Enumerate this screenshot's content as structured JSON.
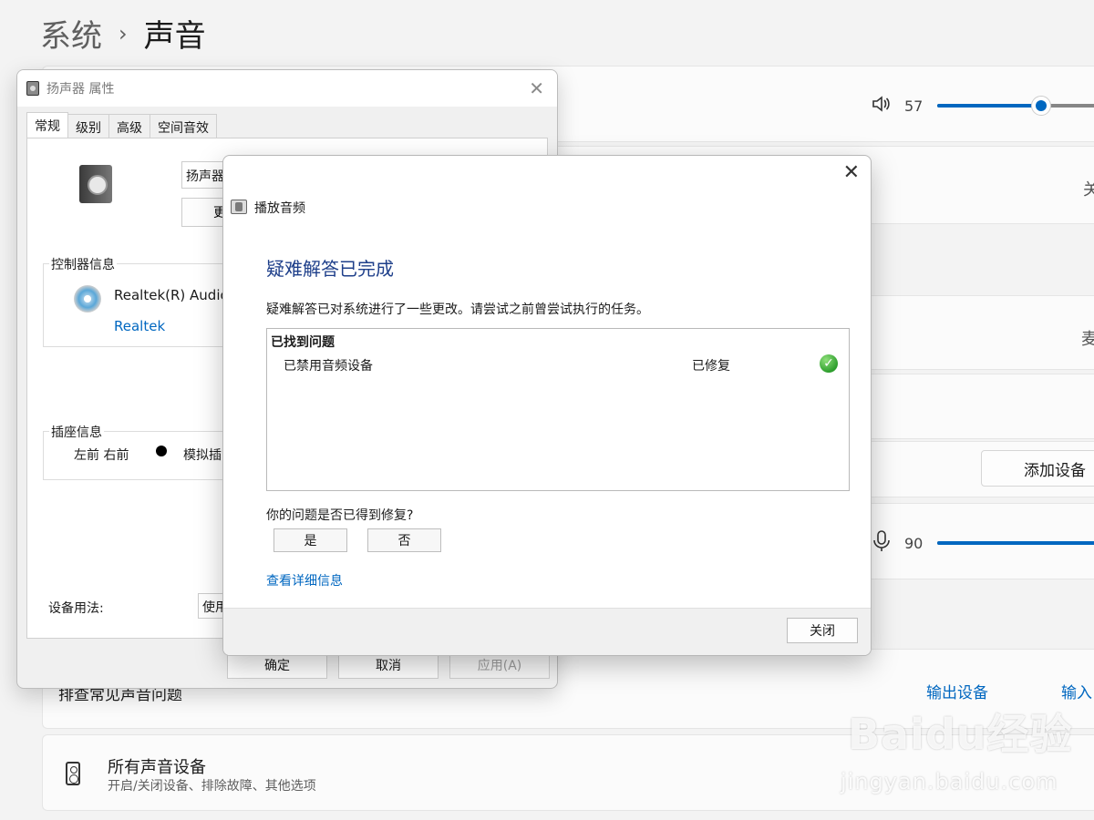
{
  "breadcrumb": {
    "parent": "系统",
    "separator": "›",
    "current": "声音"
  },
  "output_volume": {
    "value": "57",
    "level_percent": 57
  },
  "input_volume": {
    "value": "90",
    "level_percent": 90
  },
  "edge_labels": {
    "row_b": "关",
    "row_d": "麦"
  },
  "add_device_label": "添加设备",
  "troubleshoot": {
    "title": "排查常见声音问题",
    "output_link": "输出设备",
    "input_link": "输入"
  },
  "all_devices": {
    "title": "所有声音设备",
    "subtitle": "开启/关闭设备、排除故障、其他选项"
  },
  "watermark": {
    "logo": "Baidu经验",
    "url": "jingyan.baidu.com"
  },
  "props_dialog": {
    "title": "扬声器 属性",
    "tabs": [
      "常规",
      "级别",
      "高级",
      "空间音效"
    ],
    "device_name": "扬声器",
    "change_icon_btn": "更",
    "controller_group": "控制器信息",
    "controller_name": "Realtek(R) Audio",
    "controller_vendor": "Realtek",
    "jack_group": "插座信息",
    "jack_position": "左前 右前",
    "jack_type": "模拟插",
    "usage_label": "设备用法:",
    "usage_value": "使用",
    "ok": "确定",
    "cancel": "取消",
    "apply": "应用(A)"
  },
  "ts_dialog": {
    "app_name": "播放音频",
    "heading": "疑难解答已完成",
    "description": "疑难解答已对系统进行了一些更改。请尝试之前曾尝试执行的任务。",
    "found_header": "已找到问题",
    "issue": "已禁用音频设备",
    "status": "已修复",
    "question": "你的问题是否已得到修复?",
    "yes": "是",
    "no": "否",
    "details_link": "查看详细信息",
    "close": "关闭"
  },
  "colors": {
    "accent": "#0067c0",
    "heading_blue": "#1e3f8a",
    "success_green": "#2e9e2e"
  },
  "icons": [
    "speaker-volume-icon",
    "microphone-icon",
    "speaker-device-icon",
    "cd-audio-icon",
    "check-icon",
    "close-icon"
  ]
}
